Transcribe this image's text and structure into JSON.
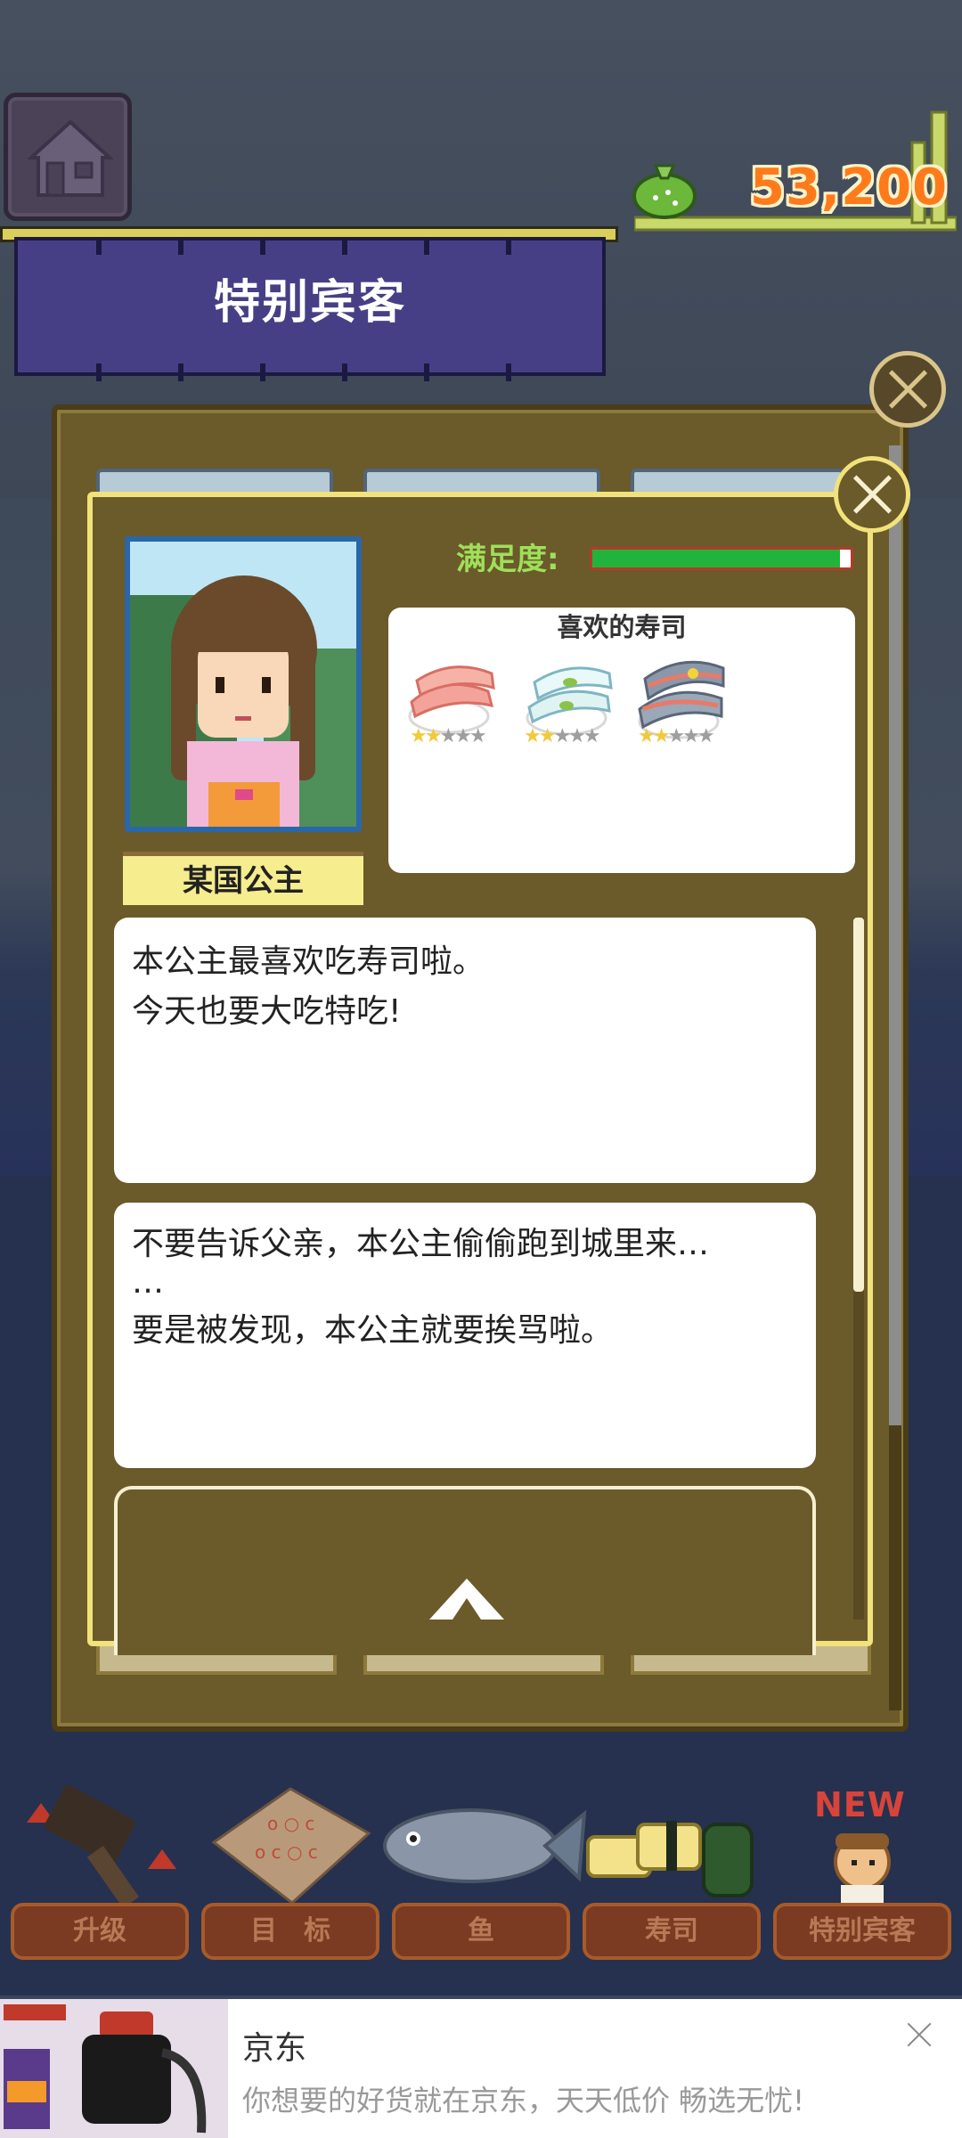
{
  "hud": {
    "coins": "53,200"
  },
  "banner": {
    "title": "特别宾客"
  },
  "guest": {
    "name": "某国公主",
    "satisfaction_label": "满足度:",
    "satisfaction_level": 0.96,
    "favorite_title": "喜欢的寿司",
    "favorite_sushi": [
      {
        "icon": "salmon-nigiri-icon",
        "stars": 2,
        "max_stars": 5
      },
      {
        "icon": "squid-nigiri-icon",
        "stars": 2,
        "max_stars": 5
      },
      {
        "icon": "mackerel-nigiri-icon",
        "stars": 2,
        "max_stars": 5
      }
    ],
    "dialogs": [
      {
        "line1": "本公主最喜欢吃寿司啦。",
        "line2": "今天也要大吃特吃!"
      },
      {
        "line1": "不要告诉父亲，本公主偷偷跑到城里来…",
        "line2": "…",
        "line3": "要是被发现，本公主就要挨骂啦。"
      }
    ]
  },
  "nav": {
    "items": [
      {
        "label": "升级",
        "icon": "hammer-icon"
      },
      {
        "label": "目　标",
        "icon": "board-icon"
      },
      {
        "label": "鱼",
        "icon": "fish-icon"
      },
      {
        "label": "寿司",
        "icon": "sushi-icon"
      },
      {
        "label": "特别宾客",
        "icon": "guest-icon"
      }
    ],
    "new_badge": "NEW"
  },
  "ad": {
    "title": "京东",
    "subtitle": "你想要的好货就在京东，天天低价 畅选无忧!"
  },
  "colors": {
    "banner": "#473f86",
    "panel": "#6b5a2a",
    "panel_border": "#f1e27a",
    "coin_text": "#ff7a1a",
    "satisfaction_fill": "#22b43a"
  }
}
